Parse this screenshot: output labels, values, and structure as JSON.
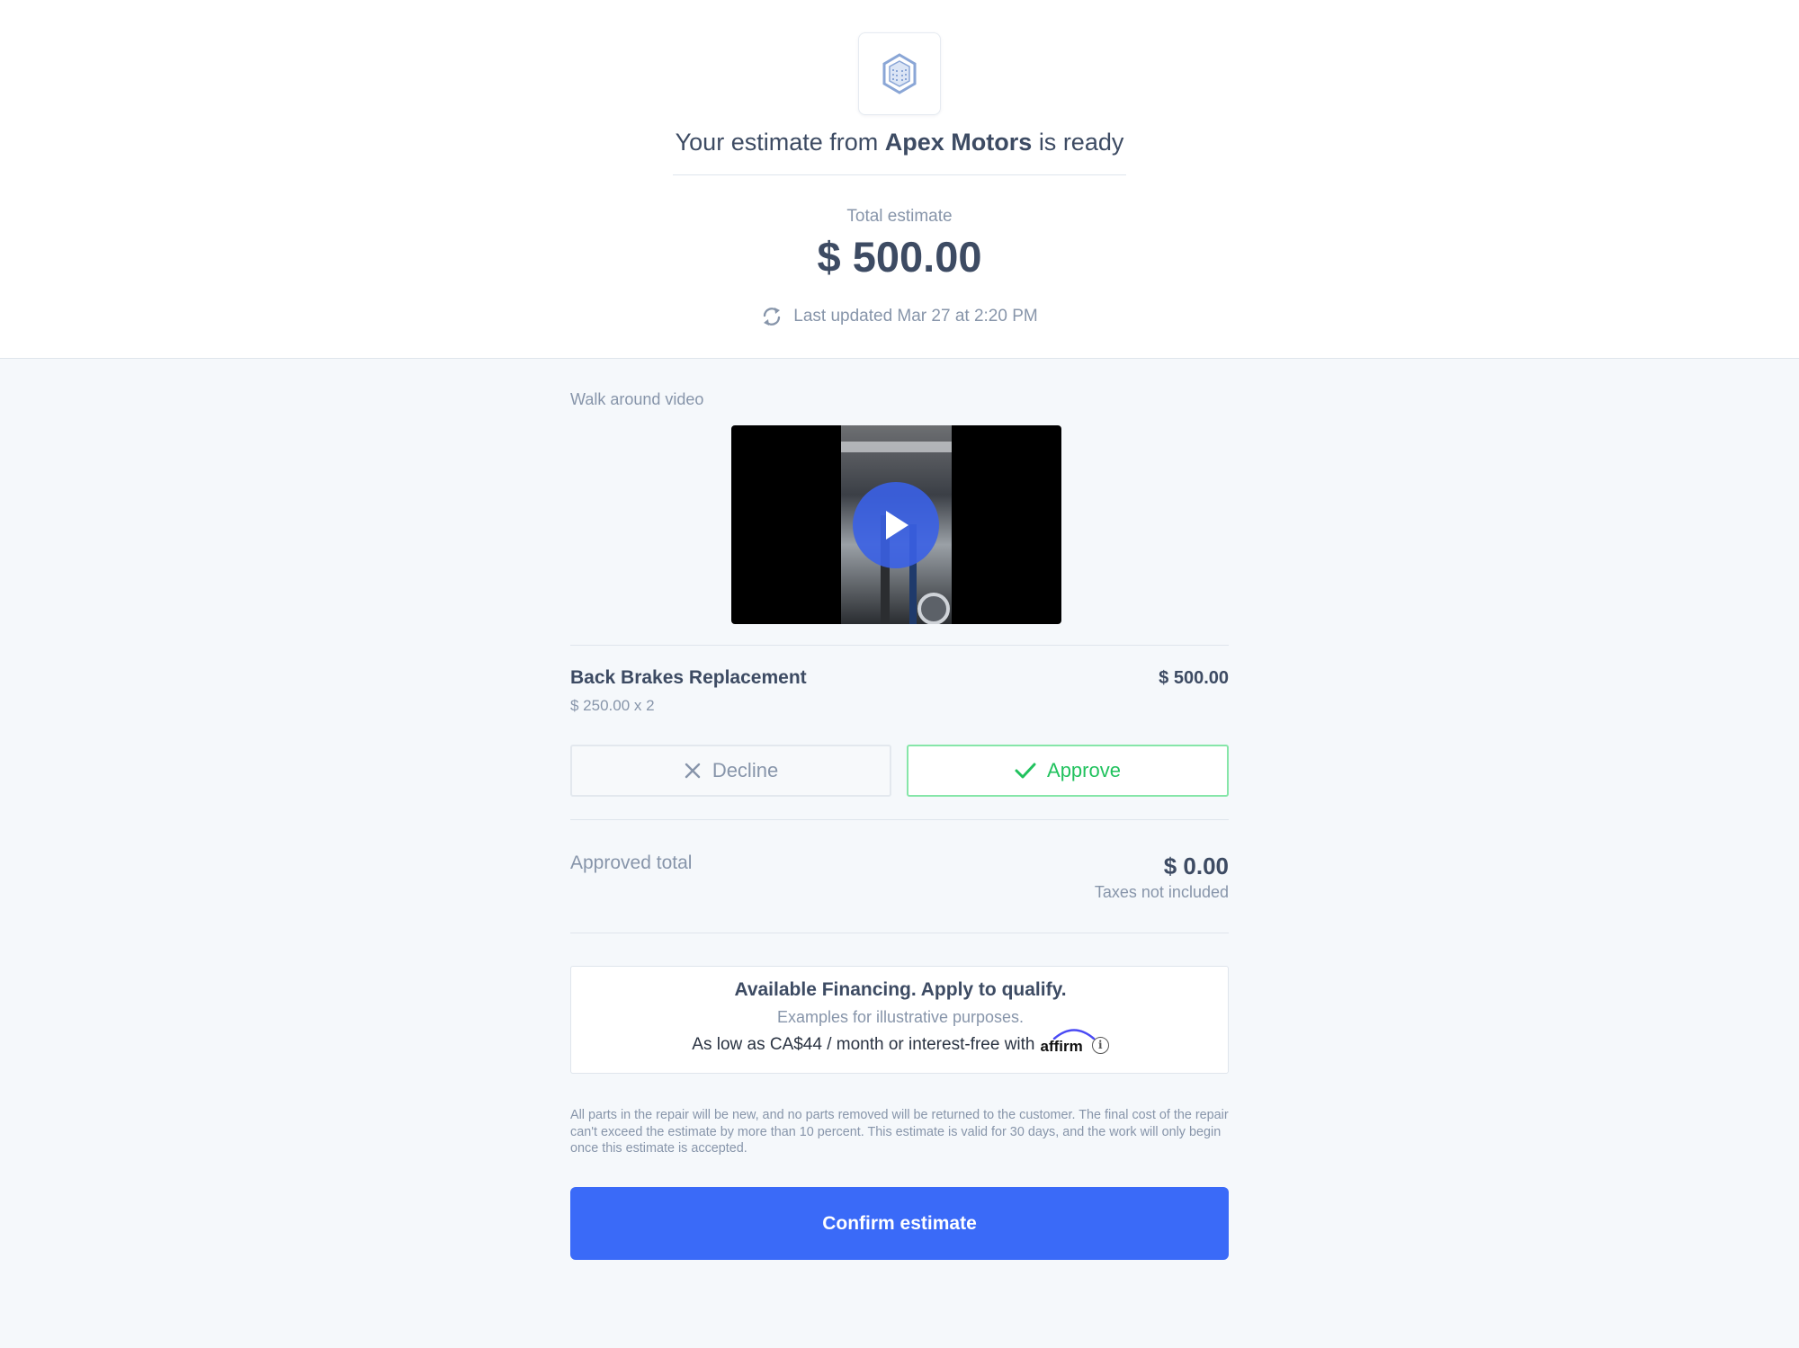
{
  "header": {
    "title_prefix": "Your estimate from",
    "shop_name": "Apex Motors",
    "title_suffix": "is ready",
    "total_label": "Total estimate",
    "total_amount": "$ 500.00",
    "last_updated": "Last updated Mar 27 at 2:20 PM",
    "logo_icon": "building-icon",
    "refresh_icon": "refresh-icon"
  },
  "video": {
    "label": "Walk around video",
    "play_icon": "play-icon"
  },
  "line_item": {
    "name": "Back Brakes Replacement",
    "unit_detail": "$ 250.00 x 2",
    "price": "$ 500.00",
    "decline_label": "Decline",
    "approve_label": "Approve"
  },
  "approved": {
    "label": "Approved total",
    "amount": "$ 0.00",
    "taxes_note": "Taxes not included"
  },
  "financing": {
    "title": "Available Financing. Apply to qualify.",
    "subtitle": "Examples for illustrative purposes.",
    "offer_text": "As low as CA$44 / month or interest-free with",
    "provider": "affirm"
  },
  "disclaimer": "All parts in the repair will be new, and no parts removed will be returned to the customer. The final cost of the repair can't exceed the estimate by more than 10 percent. This estimate is valid for 30 days, and the work will only begin once this estimate is accepted.",
  "confirm_label": "Confirm estimate",
  "colors": {
    "primary": "#3a6af8",
    "approve": "#21c25e",
    "text": "#3d4b63",
    "muted": "#8795aa"
  }
}
